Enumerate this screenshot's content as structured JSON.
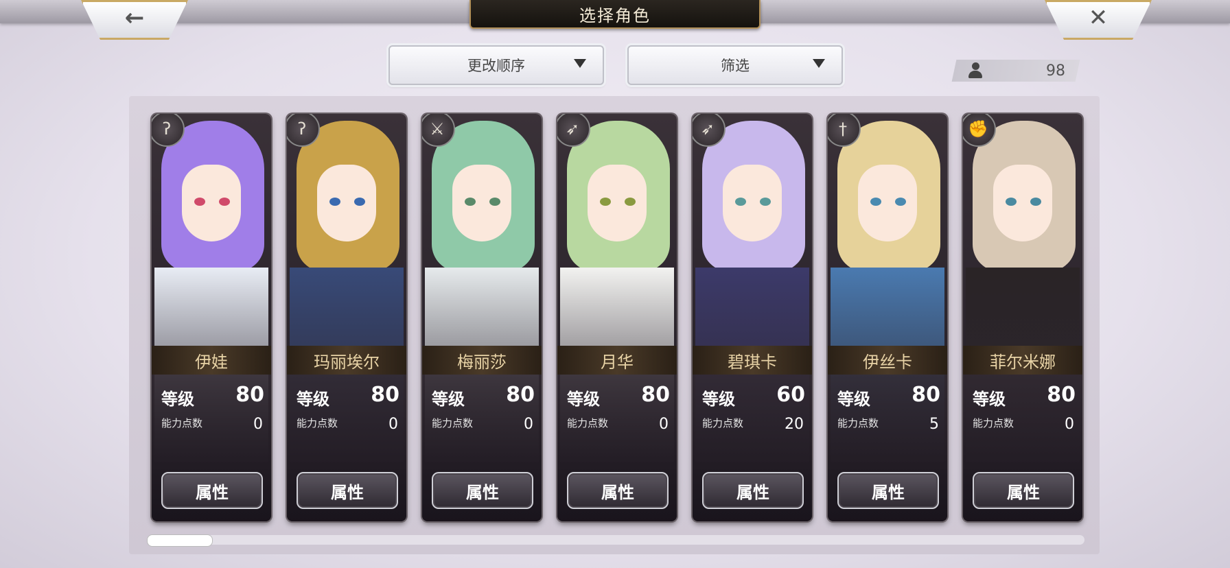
{
  "header": {
    "title": "选择角色",
    "back_icon": "←",
    "close_icon": "✕"
  },
  "controls": {
    "sort_label": "更改顺序",
    "filter_label": "筛选",
    "character_count": "98"
  },
  "labels": {
    "level": "等级",
    "ability_points": "能力点数",
    "attributes_button": "属性"
  },
  "characters": [
    {
      "name": "伊娃",
      "level": "80",
      "ability_points": "0",
      "role_icon": "staff-icon",
      "role_glyph": "ʔ",
      "hair": "#a07ee8",
      "eye": "#d04a6a",
      "outfit": "#e8ecf4"
    },
    {
      "name": "玛丽埃尔",
      "level": "80",
      "ability_points": "0",
      "role_icon": "staff-icon",
      "role_glyph": "ʔ",
      "hair": "#c9a24a",
      "eye": "#3a6ab0",
      "outfit": "#384a78"
    },
    {
      "name": "梅丽莎",
      "level": "80",
      "ability_points": "0",
      "role_icon": "blade-icon",
      "role_glyph": "⚔",
      "hair": "#8fc9a8",
      "eye": "#5a8a6a",
      "outfit": "#e6eaec"
    },
    {
      "name": "月华",
      "level": "80",
      "ability_points": "0",
      "role_icon": "bow-icon",
      "role_glyph": "➶",
      "hair": "#b8d8a0",
      "eye": "#8a9a40",
      "outfit": "#f2f2f0"
    },
    {
      "name": "碧琪卡",
      "level": "60",
      "ability_points": "20",
      "role_icon": "bow-icon",
      "role_glyph": "➶",
      "hair": "#c8b8ec",
      "eye": "#5a9a9a",
      "outfit": "#3c3a6a"
    },
    {
      "name": "伊丝卡",
      "level": "80",
      "ability_points": "5",
      "role_icon": "sword-icon",
      "role_glyph": "†",
      "hair": "#e6d29a",
      "eye": "#4a8ab0",
      "outfit": "#4a7ab0"
    },
    {
      "name": "菲尔米娜",
      "level": "80",
      "ability_points": "0",
      "role_icon": "gauntlet-icon",
      "role_glyph": "✊",
      "hair": "#d8c8b4",
      "eye": "#4a8aa0",
      "outfit": "#2a2426"
    }
  ]
}
